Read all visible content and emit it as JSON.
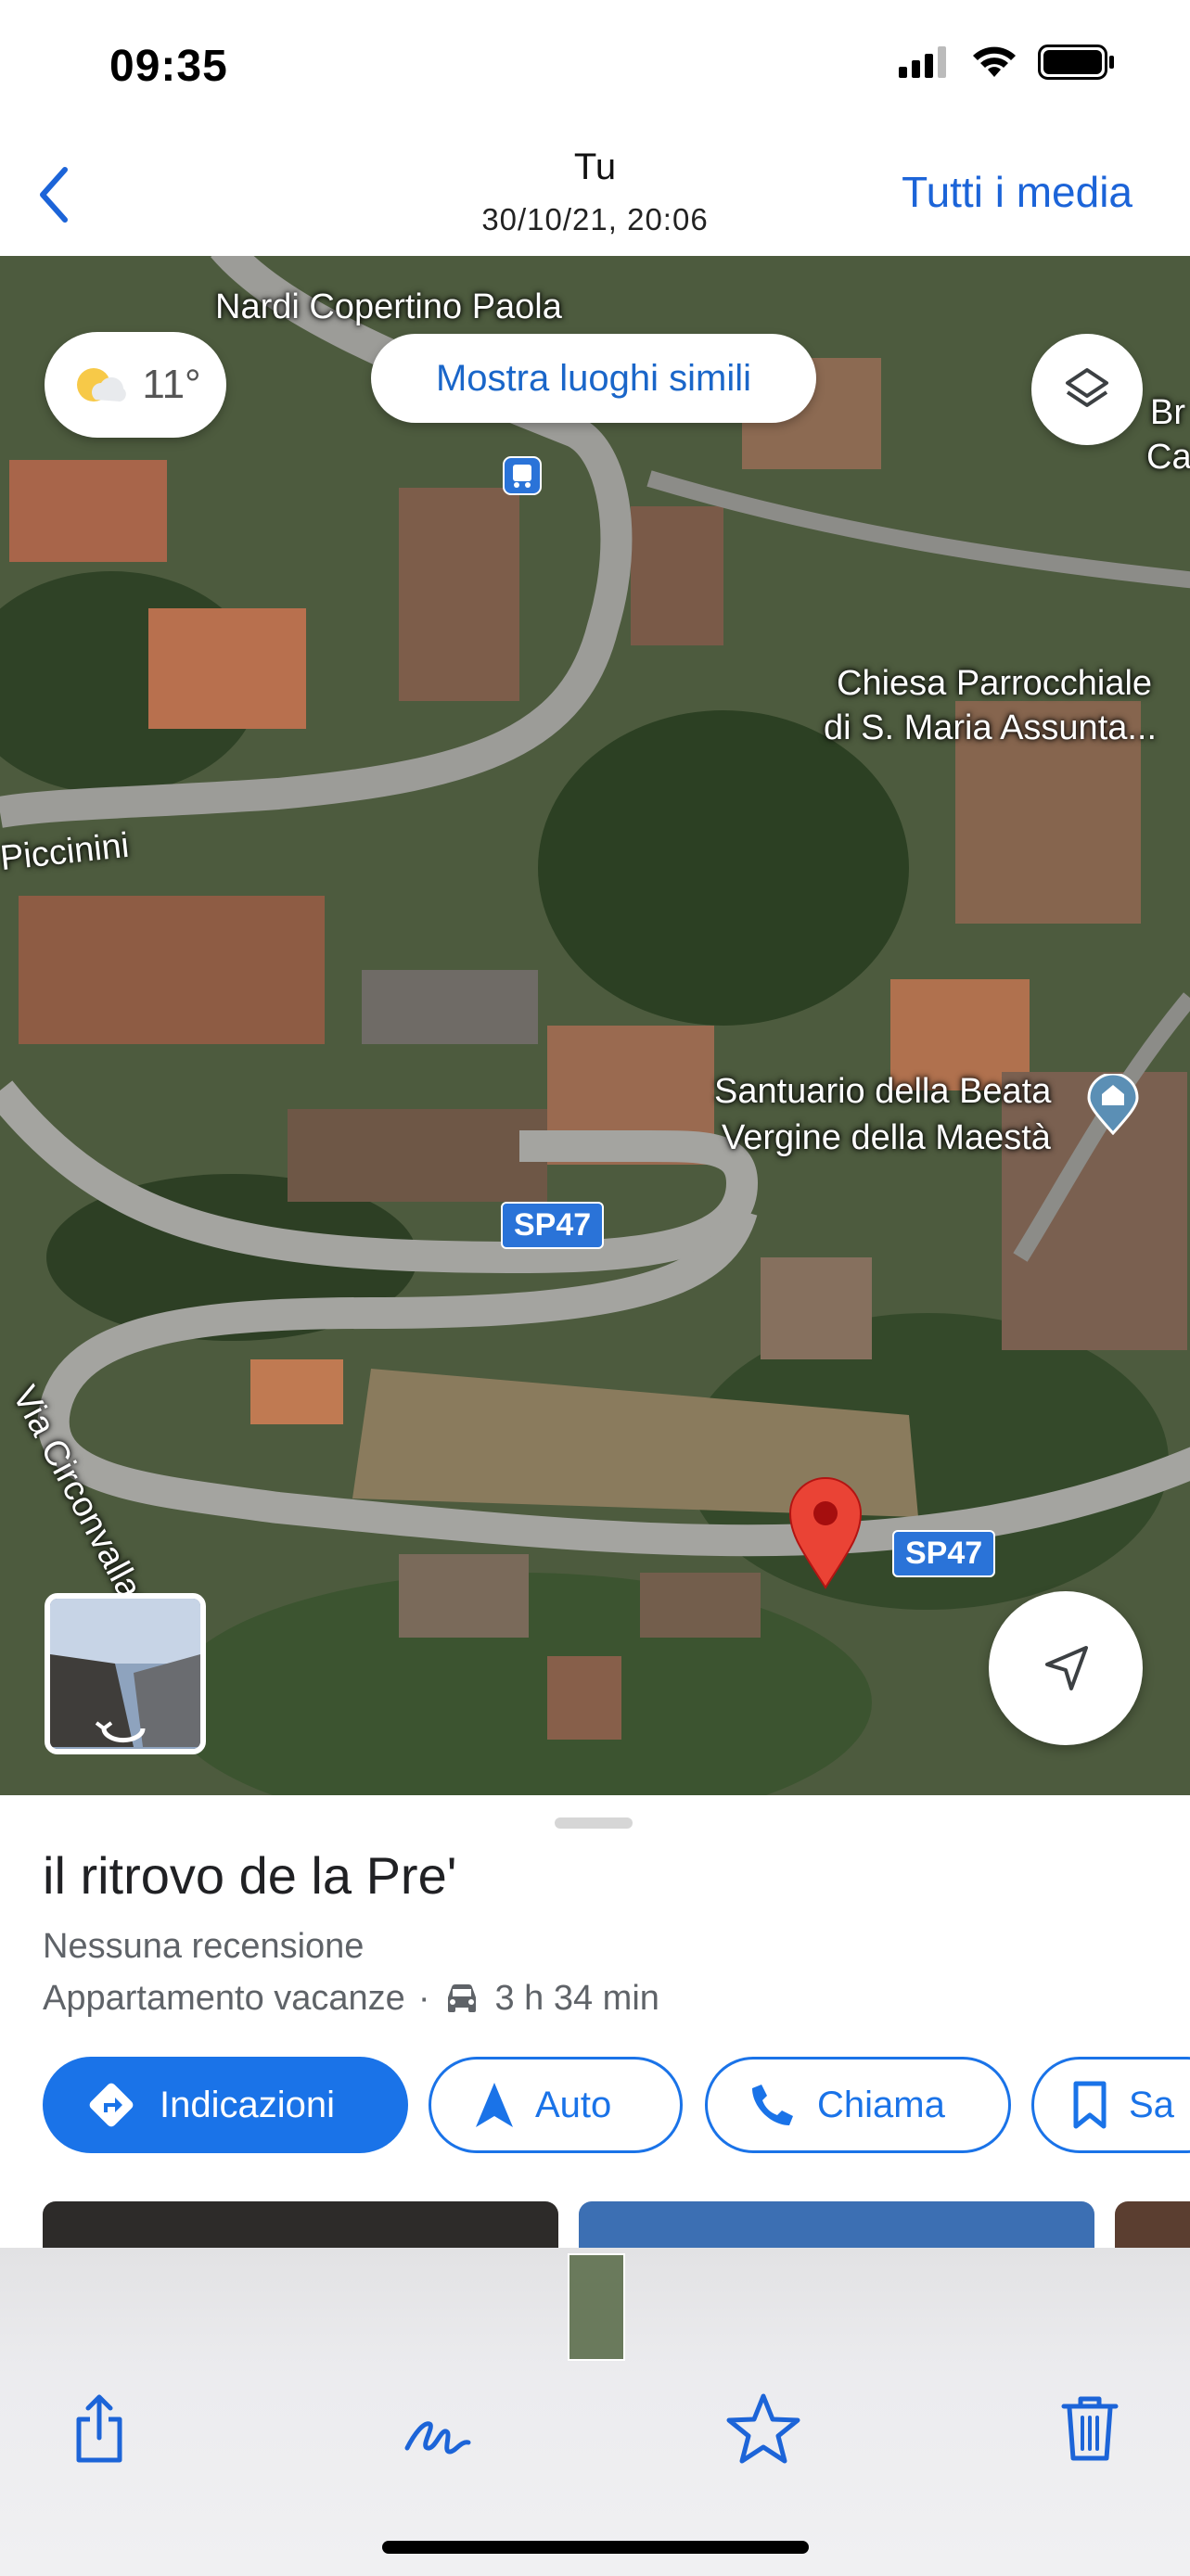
{
  "status_bar": {
    "time": "09:35"
  },
  "nav_bar": {
    "title": "Tu",
    "subtitle": "30/10/21, 20:06",
    "all_media_label": "Tutti i media",
    "back_icon": "chevron-left-icon"
  },
  "map": {
    "weather": {
      "temp": "11°",
      "icon": "partly-cloudy-icon"
    },
    "similar_places_label": "Mostra luoghi simili",
    "layers_icon": "layers-icon",
    "labels": {
      "nardi": "Nardi Copertino Paola",
      "chiesa_line1": "Chiesa Parrocchiale",
      "chiesa_line2": "di S. Maria Assunta...",
      "santuario_line1": "Santuario della Beata",
      "santuario_line2": "Vergine della Maestà",
      "piccinini": "Piccinini",
      "via_circonvallazione": "Via Circonvallazione",
      "edge_br": "Br",
      "edge_ca": "Ca"
    },
    "road_badges": [
      "SP47",
      "SP47"
    ],
    "compass_icon": "navigation-arrow-icon",
    "accent_color": "#1a73e8",
    "pin_color": "#ea4335"
  },
  "place": {
    "title": "il ritrovo de la Pre'",
    "reviews": "Nessuna recensione",
    "category": "Appartamento vacanze",
    "separator": "·",
    "drive_time": "3 h 34 min",
    "actions": {
      "directions": "Indicazioni",
      "auto": "Auto",
      "call": "Chiama",
      "save": "Sa"
    }
  },
  "toolbar": {
    "share_icon": "share-icon",
    "markup_icon": "markup-pen-icon",
    "favorite_icon": "star-icon",
    "delete_icon": "trash-icon",
    "tint_color": "#1c64d8"
  }
}
